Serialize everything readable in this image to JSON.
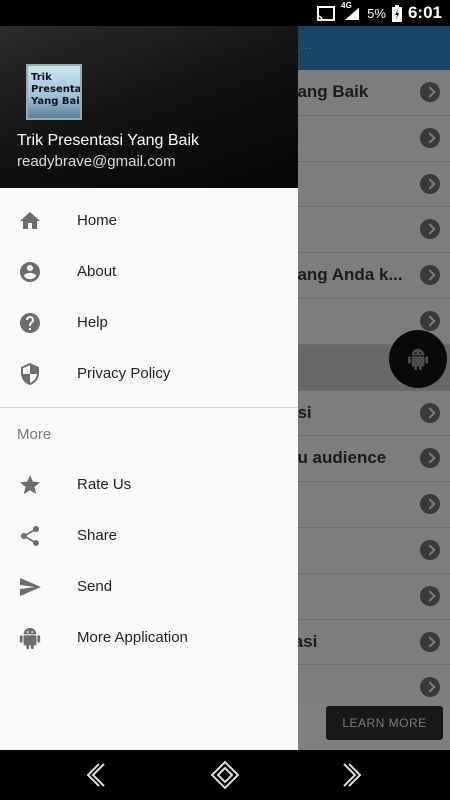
{
  "status": {
    "network": "4G",
    "battery": "5%",
    "time": "6:01"
  },
  "background": {
    "appbar_hint": "...",
    "rows": [
      {
        "text": "yang Baik",
        "header": false
      },
      {
        "text": "",
        "header": false
      },
      {
        "text": "",
        "header": false
      },
      {
        "text": "",
        "header": false
      },
      {
        "text": "yang Anda k...",
        "header": false
      },
      {
        "text": "",
        "header": false
      },
      {
        "text": "",
        "header": true
      },
      {
        "text": "asi",
        "header": false
      },
      {
        "text": "au audience",
        "header": false
      },
      {
        "text": "",
        "header": false
      },
      {
        "text": "",
        "header": false
      },
      {
        "text": "",
        "header": false
      },
      {
        "text": "tasi",
        "header": false
      },
      {
        "text": "",
        "header": false
      }
    ],
    "ad_button": "LEARN MORE"
  },
  "drawer": {
    "app_icon_text": "Trik Presentasi Yang Baik",
    "name": "Trik Presentasi Yang Baik",
    "email": "readybrave@gmail.com",
    "menu": [
      {
        "label": "Home",
        "icon": "home-icon"
      },
      {
        "label": "About",
        "icon": "account-circle-icon"
      },
      {
        "label": "Help",
        "icon": "help-icon"
      },
      {
        "label": "Privacy Policy",
        "icon": "shield-icon"
      }
    ],
    "section_title": "More",
    "more": [
      {
        "label": "Rate Us",
        "icon": "star-icon"
      },
      {
        "label": "Share",
        "icon": "share-icon"
      },
      {
        "label": "Send",
        "icon": "send-icon"
      },
      {
        "label": "More Application",
        "icon": "android-icon"
      }
    ]
  },
  "colors": {
    "appbar": "#2a7fb8",
    "drawer_bg": "#fafafa",
    "icon_grey": "#6d6d6d"
  }
}
